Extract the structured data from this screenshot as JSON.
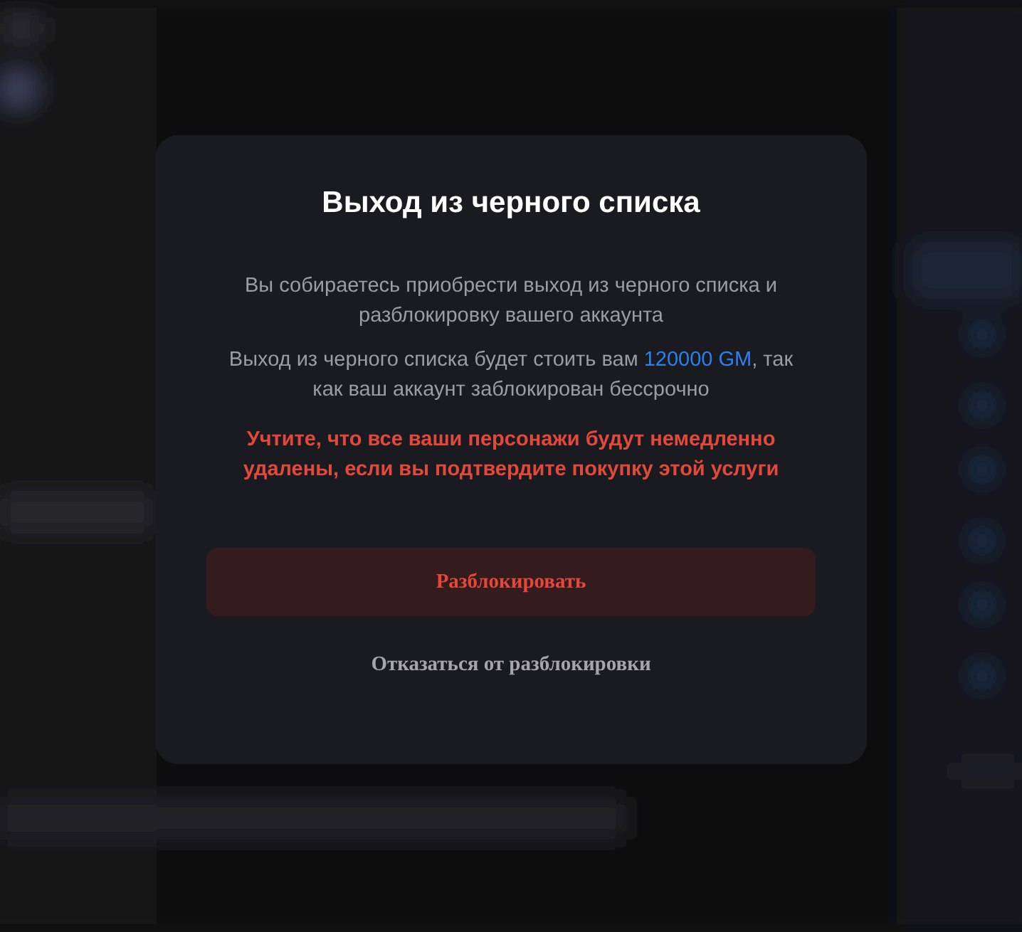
{
  "dialog": {
    "title": "Выход из черного списка",
    "description": "Вы собираетесь приобрести выход из черного списка и разблокировку вашего аккаунта",
    "price_note": {
      "before": "Выход из черного списка будет стоить вам ",
      "price": "120000 GM",
      "after": ", так как ваш аккаунт заблокирован бессрочно"
    },
    "warning": "Учтите, что все ваши персонажи будут немедленно удалены, если вы подтвердите покупку этой услуги",
    "confirm_button": "Разблокировать",
    "cancel_link": "Отказаться от разблокировки"
  }
}
